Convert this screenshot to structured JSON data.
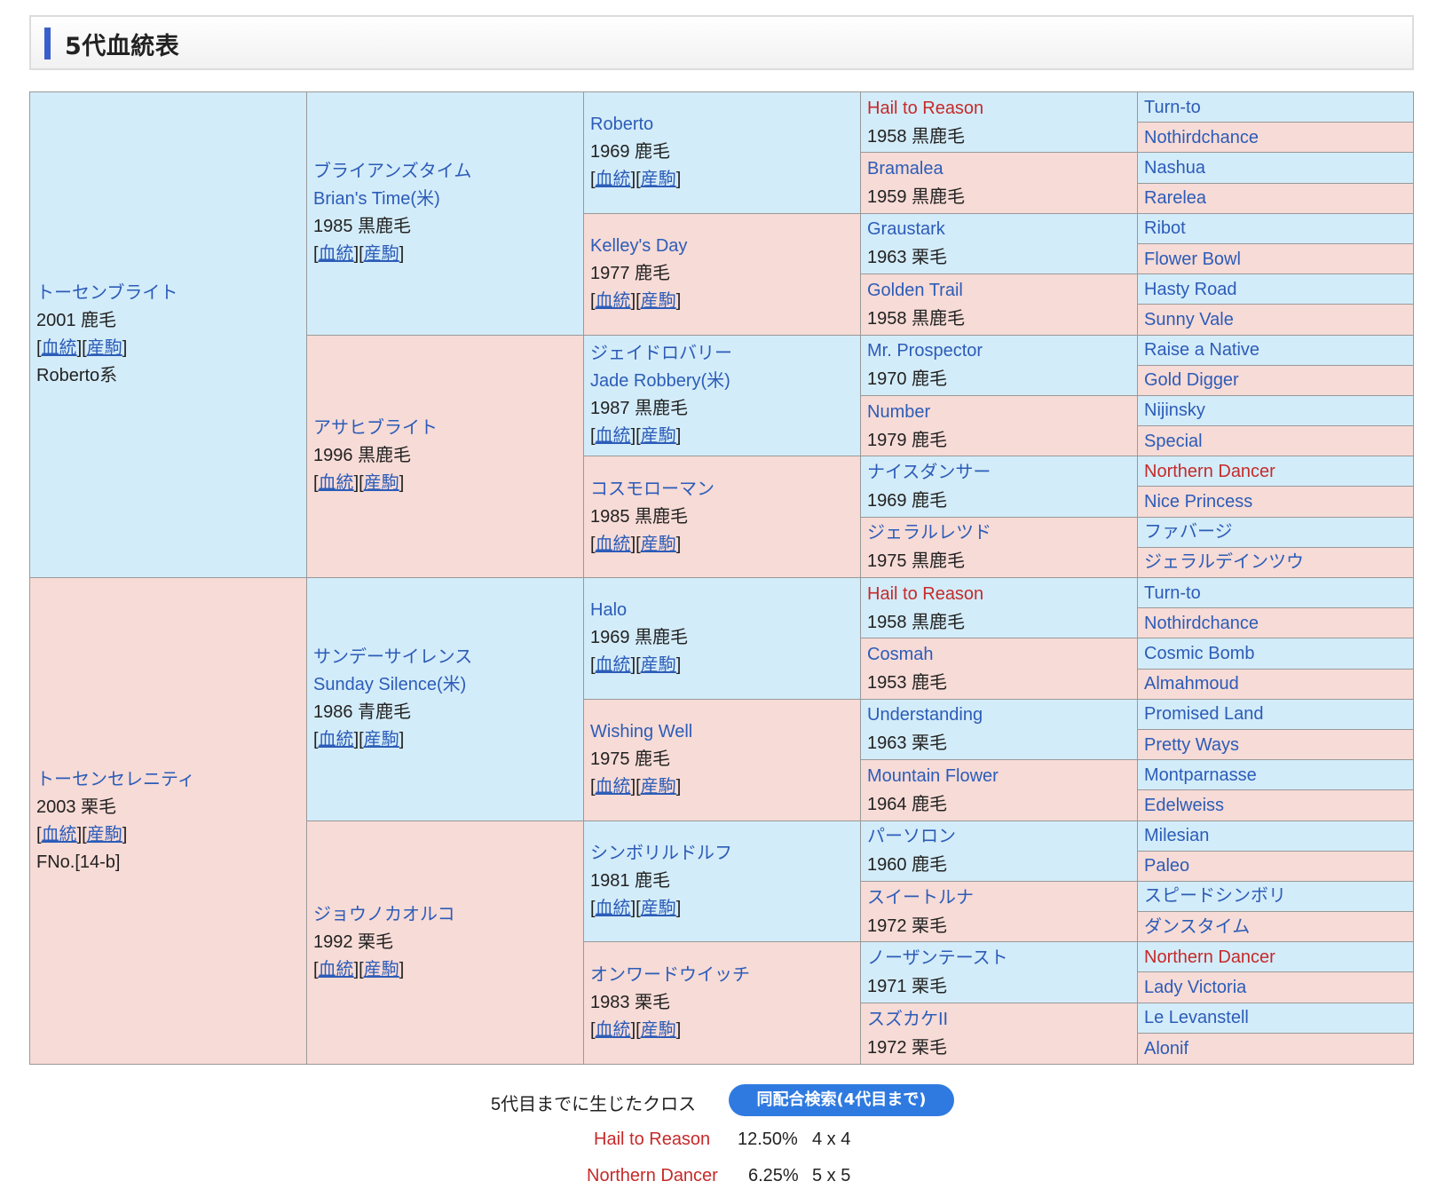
{
  "header": {
    "title": "5代血統表"
  },
  "links": {
    "pedigree": "血統",
    "progeny": "産駒"
  },
  "gen1": [
    {
      "name": "トーセンブライト",
      "detail": "2001 鹿毛",
      "links": true,
      "extra": "Roberto系"
    },
    {
      "name": "トーセンセレニティ",
      "detail": "2003 栗毛",
      "links": true,
      "extra": "FNo.[14-b]"
    }
  ],
  "gen2": [
    {
      "name": "ブライアンズタイム",
      "name2": "Brian's Time(米)",
      "detail": "1985 黒鹿毛",
      "links": true
    },
    {
      "name": "アサヒブライト",
      "detail": "1996 黒鹿毛",
      "links": true
    },
    {
      "name": "サンデーサイレンス",
      "name2": "Sunday Silence(米)",
      "detail": "1986 青鹿毛",
      "links": true
    },
    {
      "name": "ジョウノカオルコ",
      "detail": "1992 栗毛",
      "links": true
    }
  ],
  "gen3": [
    {
      "name": "Roberto",
      "detail": "1969 鹿毛",
      "links": true
    },
    {
      "name": "Kelley's Day",
      "detail": "1977 鹿毛",
      "links": true
    },
    {
      "name": "ジェイドロバリー",
      "name2": "Jade Robbery(米)",
      "detail": "1987 黒鹿毛",
      "links": true
    },
    {
      "name": "コスモローマン",
      "detail": "1985 黒鹿毛",
      "links": true
    },
    {
      "name": "Halo",
      "detail": "1969 黒鹿毛",
      "links": true
    },
    {
      "name": "Wishing Well",
      "detail": "1975 鹿毛",
      "links": true
    },
    {
      "name": "シンボリルドルフ",
      "detail": "1981 鹿毛",
      "links": true
    },
    {
      "name": "オンワードウイッチ",
      "detail": "1983 栗毛",
      "links": true
    }
  ],
  "gen4": [
    {
      "name": "Hail to Reason",
      "detail": "1958 黒鹿毛",
      "cross": true
    },
    {
      "name": "Bramalea",
      "detail": "1959 黒鹿毛"
    },
    {
      "name": "Graustark",
      "detail": "1963 栗毛"
    },
    {
      "name": "Golden Trail",
      "detail": "1958 黒鹿毛"
    },
    {
      "name": "Mr. Prospector",
      "detail": "1970 鹿毛"
    },
    {
      "name": "Number",
      "detail": "1979 鹿毛"
    },
    {
      "name": "ナイスダンサー",
      "detail": "1969 鹿毛"
    },
    {
      "name": "ジェラルレツド",
      "detail": "1975 黒鹿毛"
    },
    {
      "name": "Hail to Reason",
      "detail": "1958 黒鹿毛",
      "cross": true
    },
    {
      "name": "Cosmah",
      "detail": "1953 鹿毛"
    },
    {
      "name": "Understanding",
      "detail": "1963 栗毛"
    },
    {
      "name": "Mountain Flower",
      "detail": "1964 鹿毛"
    },
    {
      "name": "パーソロン",
      "detail": "1960 鹿毛"
    },
    {
      "name": "スイートルナ",
      "detail": "1972 栗毛"
    },
    {
      "name": "ノーザンテースト",
      "detail": "1971 栗毛"
    },
    {
      "name": "スズカケII",
      "detail": "1972 栗毛"
    }
  ],
  "gen5": [
    {
      "name": "Turn-to"
    },
    {
      "name": "Nothirdchance"
    },
    {
      "name": "Nashua"
    },
    {
      "name": "Rarelea"
    },
    {
      "name": "Ribot"
    },
    {
      "name": "Flower Bowl"
    },
    {
      "name": "Hasty Road"
    },
    {
      "name": "Sunny Vale"
    },
    {
      "name": "Raise a Native"
    },
    {
      "name": "Gold Digger"
    },
    {
      "name": "Nijinsky"
    },
    {
      "name": "Special"
    },
    {
      "name": "Northern Dancer",
      "cross": true
    },
    {
      "name": "Nice Princess"
    },
    {
      "name": "ファバージ"
    },
    {
      "name": "ジェラルデインツウ"
    },
    {
      "name": "Turn-to"
    },
    {
      "name": "Nothirdchance"
    },
    {
      "name": "Cosmic Bomb"
    },
    {
      "name": "Almahmoud"
    },
    {
      "name": "Promised Land"
    },
    {
      "name": "Pretty Ways"
    },
    {
      "name": "Montparnasse"
    },
    {
      "name": "Edelweiss"
    },
    {
      "name": "Milesian"
    },
    {
      "name": "Paleo"
    },
    {
      "name": "スピードシンボリ"
    },
    {
      "name": "ダンスタイム"
    },
    {
      "name": "Northern Dancer",
      "cross": true
    },
    {
      "name": "Lady Victoria"
    },
    {
      "name": "Le Levanstell"
    },
    {
      "name": "Alonif"
    }
  ],
  "cross_section": {
    "label": "5代目までに生じたクロス",
    "search_button": "同配合検索(4代目まで)",
    "crosses": [
      {
        "name": "Hail to Reason",
        "percent": "12.50%",
        "generation": "4 x 4"
      },
      {
        "name": "Northern Dancer",
        "percent": "6.25%",
        "generation": "5 x 5"
      }
    ]
  }
}
